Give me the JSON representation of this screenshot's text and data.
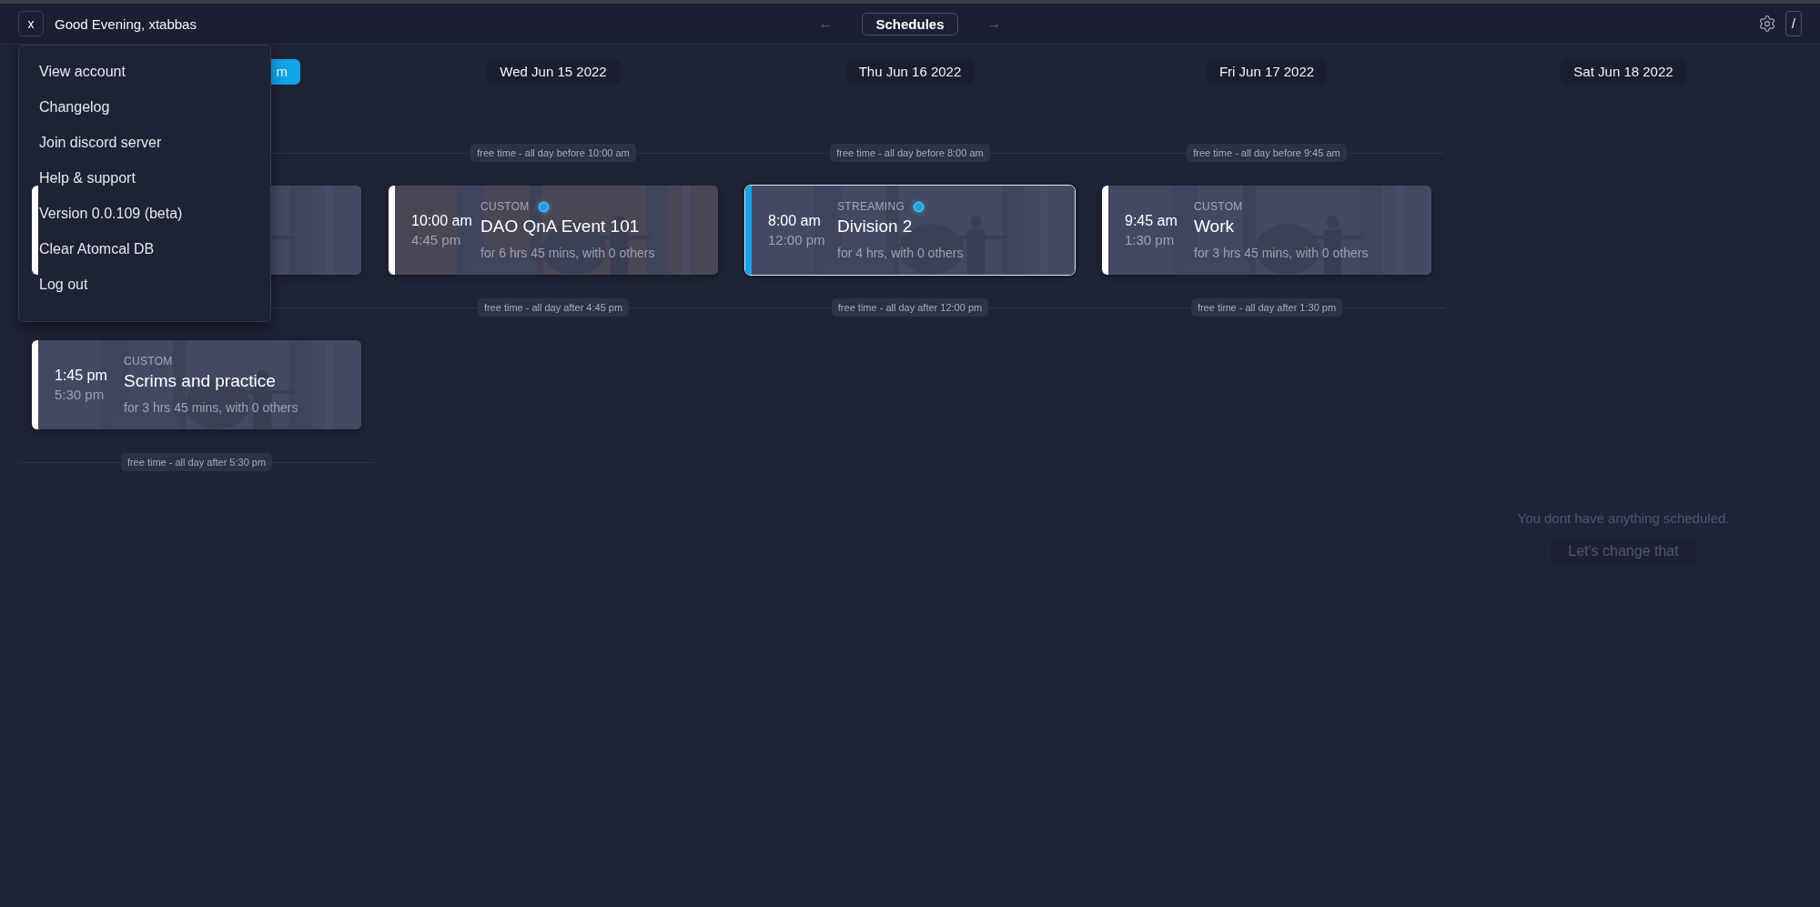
{
  "topbar": {
    "close": "x",
    "greeting": "Good Evening, xtabbas",
    "prev": "←",
    "title": "Schedules",
    "next": "→",
    "shortcut": "/"
  },
  "menu": {
    "items": [
      "View account",
      "Changelog",
      "Join discord server",
      "Help & support",
      "Version 0.0.109 (beta)",
      "Clear Atomcal DB",
      "Log out"
    ]
  },
  "columns": [
    {
      "header": "m",
      "today": true,
      "slots": [
        {
          "kind": "event",
          "selected": false
        },
        {
          "kind": "free"
        },
        {
          "kind": "event",
          "start": "1:45 pm",
          "end": "5:30 pm",
          "category": "CUSTOM",
          "title": "Scrims and practice",
          "detail": "for 3 hrs 45 mins, with 0 others",
          "selected": false,
          "live": false
        },
        {
          "kind": "free",
          "text": "free time - all day after 5:30 pm"
        }
      ]
    },
    {
      "header": "Wed Jun 15 2022",
      "today": false,
      "slots": [
        {
          "kind": "free",
          "text": "free time - all day before 10:00 am"
        },
        {
          "kind": "event",
          "start": "10:00 am",
          "end": "4:45 pm",
          "category": "CUSTOM",
          "title": "DAO QnA Event 101",
          "detail": "for 6 hrs 45 mins, with 0 others",
          "selected": false,
          "live": true
        },
        {
          "kind": "free",
          "text": "free time - all day after 4:45 pm"
        }
      ]
    },
    {
      "header": "Thu Jun 16 2022",
      "today": false,
      "slots": [
        {
          "kind": "free",
          "text": "free time - all day before 8:00 am"
        },
        {
          "kind": "event",
          "start": "8:00 am",
          "end": "12:00 pm",
          "category": "STREAMING",
          "title": "Division 2",
          "detail": "for 4 hrs, with 0 others",
          "selected": true,
          "live": true
        },
        {
          "kind": "free",
          "text": "free time - all day after 12:00 pm"
        }
      ]
    },
    {
      "header": "Fri Jun 17 2022",
      "today": false,
      "slots": [
        {
          "kind": "free",
          "text": "free time - all day before 9:45 am"
        },
        {
          "kind": "event",
          "start": "9:45 am",
          "end": "1:30 pm",
          "category": "CUSTOM",
          "title": "Work",
          "detail": "for 3 hrs 45 mins, with 0 others",
          "selected": false,
          "live": false
        },
        {
          "kind": "free",
          "text": "free time - all day after 1:30 pm"
        }
      ]
    },
    {
      "header": "Sat Jun 18 2022",
      "today": false,
      "empty": {
        "message": "You dont have anything scheduled.",
        "action": "Let's change that"
      }
    }
  ]
}
